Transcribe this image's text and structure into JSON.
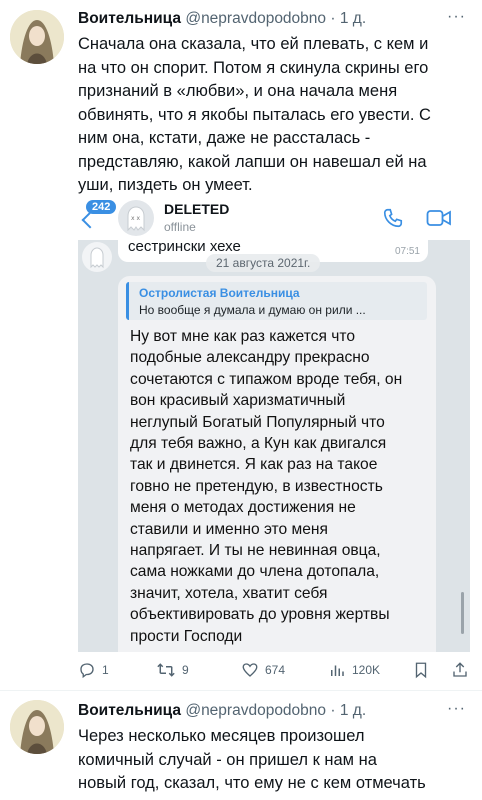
{
  "tweet1": {
    "name": "Воительница",
    "handle": "@nepravdopodobno",
    "time": "1 д.",
    "more": "···",
    "text": "Сначала она сказала, что ей плевать, с кем и\nна что он спорит. Потом я скинула скрины его\nпризнаний в «любви», и она начала меня\nобвинять, что я якобы пыталась его увести. С\nним она, кстати, даже не рассталась -\nпредставляю, какой лапши он навешал ей на\nуши, пиздеть он умеет.",
    "actions": {
      "replies": "1",
      "retweets": "9",
      "likes": "674",
      "views": "120K"
    }
  },
  "screenshot": {
    "badge": "242",
    "contact_name": "DELETED",
    "contact_status": "offline",
    "prev_message": "сестрински хехе",
    "prev_time": "07:51",
    "date_pill": "21 августа 2021г.",
    "quote_name": "Остролистая Воительница",
    "quote_text": "Но вообще я думала и думаю он рили ...",
    "message": "Ну вот мне как раз кажется что\nподобные александру прекрасно\nсочетаются с типажом вроде тебя, он\nвон красивый харизматичный\nнеглупый Богатый Популярный что\nдля тебя важно,  а Кун как двигался\nтак и двинется. Я как раз на такое\nговно не претендую, в известность\nменя о методах достижения не\nставили и именно это меня\nнапрягает. И ты не невинная овца,\nсама ножками до члена дотопала,\nзначит, хотела, хватит себя\nобъективировать до уровня жертвы\nпрости Господи",
    "accent": "#3a8fe3"
  },
  "tweet2": {
    "name": "Воительница",
    "handle": "@nepravdopodobno",
    "time": "1 д.",
    "more": "···",
    "text": "Через несколько месяцев произошел\nкомичный случай - он пришел к нам  на\nновый год, сказал, что ему не с кем отмечать"
  }
}
